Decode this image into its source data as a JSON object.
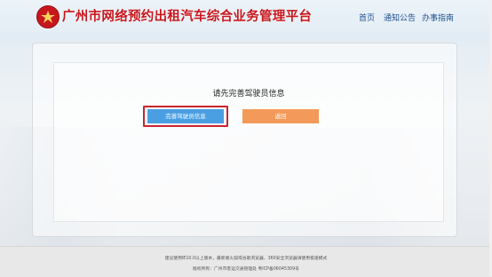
{
  "header": {
    "title": "广州市网络预约出租汽车综合业务管理平台",
    "logo_icon": "emblem-icon",
    "nav": {
      "home": "首页",
      "notice": "通知公告",
      "guide": "办事指南"
    }
  },
  "main": {
    "prompt": "请先完善驾驶员信息",
    "complete_button": "完善驾驶员信息",
    "back_button": "返回"
  },
  "footer": {
    "line1": "建议使用IE10.0以上版本，最新版火狐或谷歌浏览器，360安全浏览器请使用极速模式",
    "line2": "版权所有：广州市客运交通管理处  粤ICP备06045309号"
  },
  "colors": {
    "brand_red": "#c8161d",
    "nav_blue": "#1e4f8f",
    "primary_button": "#4a9fe3",
    "secondary_button": "#f39a5a",
    "focus_outline": "#c9262c"
  }
}
